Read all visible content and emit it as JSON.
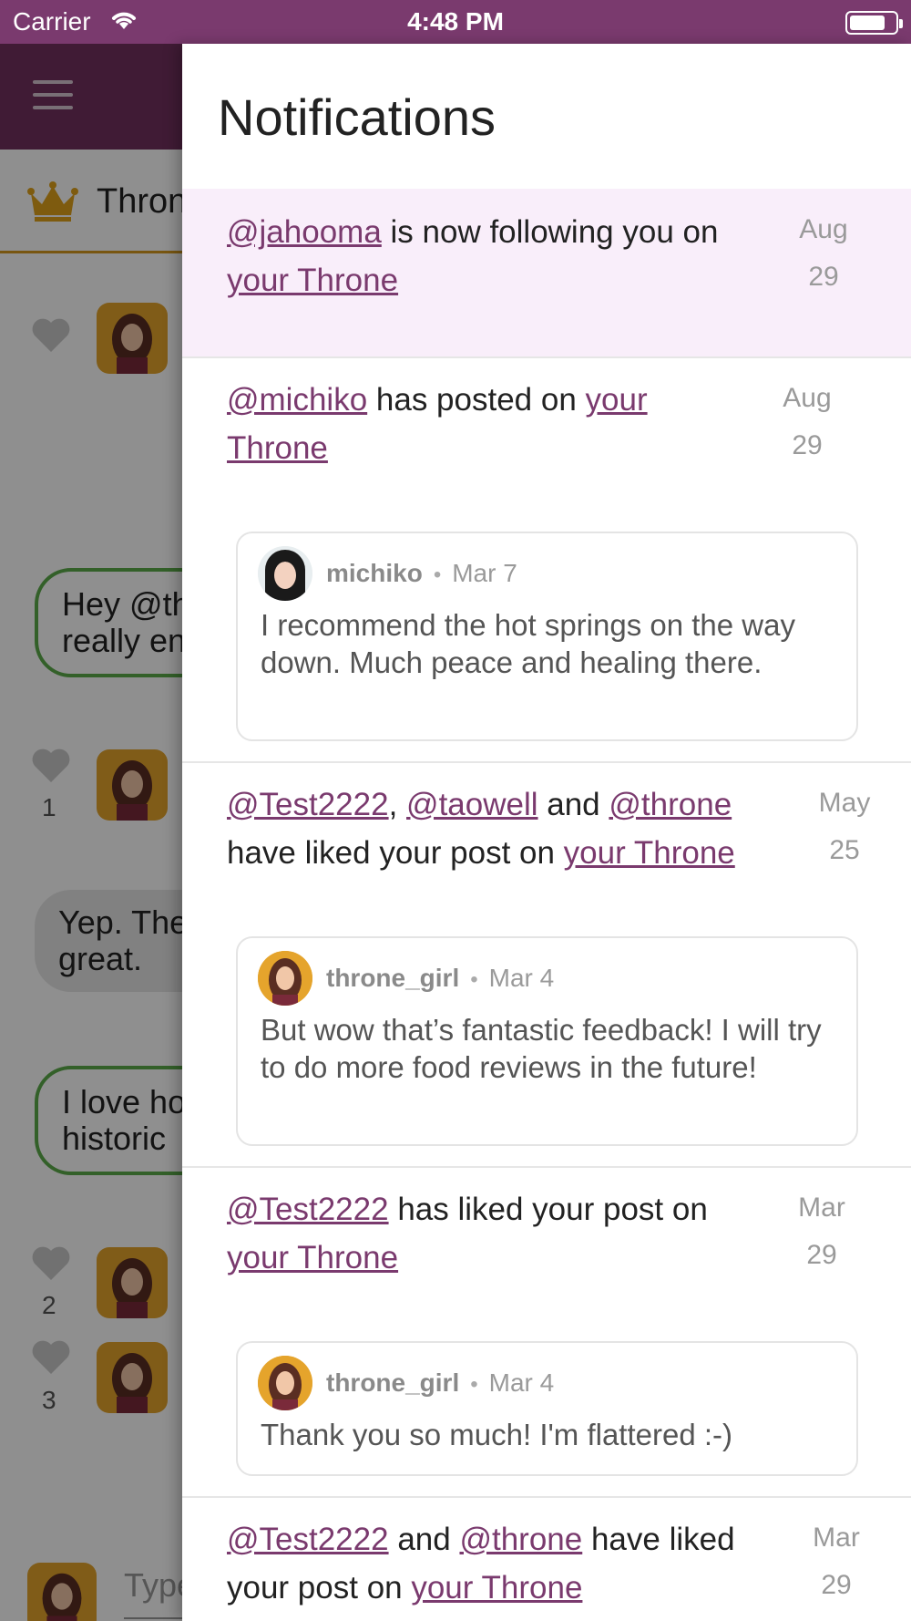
{
  "status_bar": {
    "carrier": "Carrier",
    "time": "4:48 PM",
    "battery_level": 0.7
  },
  "background": {
    "tab_label": "Throne",
    "bubbles": [
      {
        "line1": "Hey @th",
        "line2": "really en"
      },
      {
        "line1": "Yep. The",
        "line2": "great."
      },
      {
        "line1": "I love ho",
        "line2": "historic"
      }
    ],
    "like_counts": [
      "1",
      "2",
      "3"
    ],
    "input_placeholder": "Type"
  },
  "drawer": {
    "title": "Notifications",
    "notifications": [
      {
        "mention1": "@jahooma",
        "text1": " is now following you on ",
        "link": "your Throne",
        "date_month": "Aug",
        "date_day": "29",
        "unread": true
      },
      {
        "mention1": "@michiko",
        "text1": " has posted on ",
        "link": "your Throne",
        "date_month": "Aug",
        "date_day": "29",
        "quote": {
          "user": "michiko",
          "date": "Mar 7",
          "body": "I recommend the hot springs on the way down. Much peace and healing there."
        }
      },
      {
        "mention1": "@Test2222",
        "sep1": ", ",
        "mention2": "@taowell",
        "sep2": " and ",
        "mention3": "@throne",
        "text1": " have liked your post on ",
        "link": "your Throne",
        "date_month": "May",
        "date_day": "25",
        "quote": {
          "user": "throne_girl",
          "date": "Mar 4",
          "body": "But wow that’s fantastic feedback! I will try to do more food reviews in the future!"
        }
      },
      {
        "mention1": "@Test2222",
        "text1": " has liked your post on ",
        "link": "your Throne",
        "date_month": "Mar",
        "date_day": "29",
        "quote": {
          "user": "throne_girl",
          "date": "Mar 4",
          "body": "Thank you so much! I'm flattered :-)"
        }
      },
      {
        "mention1": "@Test2222",
        "sep1": " and ",
        "mention2": "@throne",
        "text1": " have liked your post on ",
        "link": "your Throne",
        "date_month": "Mar",
        "date_day": "29"
      }
    ]
  }
}
